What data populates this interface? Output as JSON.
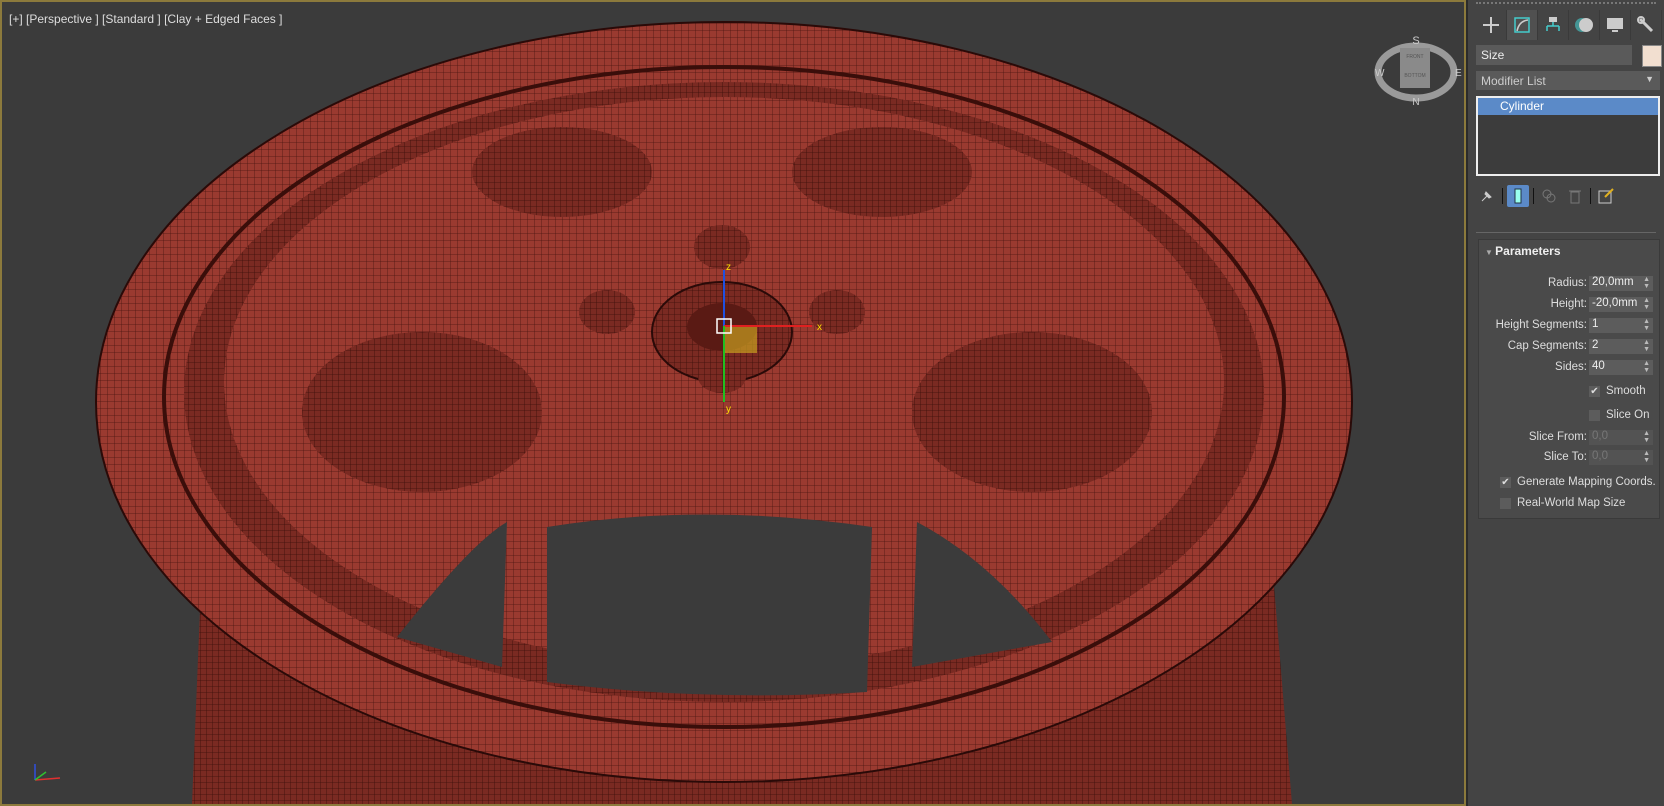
{
  "viewport": {
    "label": "[+] [Perspective ] [Standard ] [Clay + Edged Faces ]",
    "viewcube": {
      "top": "S",
      "bottom": "N",
      "left": "W",
      "right": "E",
      "face_top": "FRONT",
      "face_bottom": "BOTTOM"
    },
    "gizmo_axes": {
      "x": "x",
      "y": "y",
      "z": "z"
    },
    "mesh_color": "#9c3a30"
  },
  "panel": {
    "tabs": [
      {
        "icon": "create-plus-icon"
      },
      {
        "icon": "modify-icon",
        "active": true
      },
      {
        "icon": "hierarchy-icon"
      },
      {
        "icon": "motion-icon"
      },
      {
        "icon": "display-icon"
      },
      {
        "icon": "utilities-wrench-icon"
      }
    ],
    "object_name": "Size",
    "object_color": "#f2dfd0",
    "modifier_list": "Modifier List",
    "stack": [
      "Cylinder"
    ],
    "parameters": {
      "title": "Parameters",
      "spinners": [
        {
          "label": "Radius:",
          "value": "20,0mm"
        },
        {
          "label": "Height:",
          "value": "-20,0mm"
        },
        {
          "label": "Height Segments:",
          "value": "1"
        },
        {
          "label": "Cap Segments:",
          "value": "2"
        },
        {
          "label": "Sides:",
          "value": "40"
        }
      ],
      "smooth": {
        "label": "Smooth",
        "checked": true
      },
      "slice_on": {
        "label": "Slice On",
        "checked": false
      },
      "slice_from": {
        "label": "Slice From:",
        "value": "0,0"
      },
      "slice_to": {
        "label": "Slice To:",
        "value": "0,0"
      },
      "gen_mapping": {
        "label": "Generate Mapping Coords.",
        "checked": true
      },
      "real_world": {
        "label": "Real-World Map Size",
        "checked": false
      }
    }
  }
}
